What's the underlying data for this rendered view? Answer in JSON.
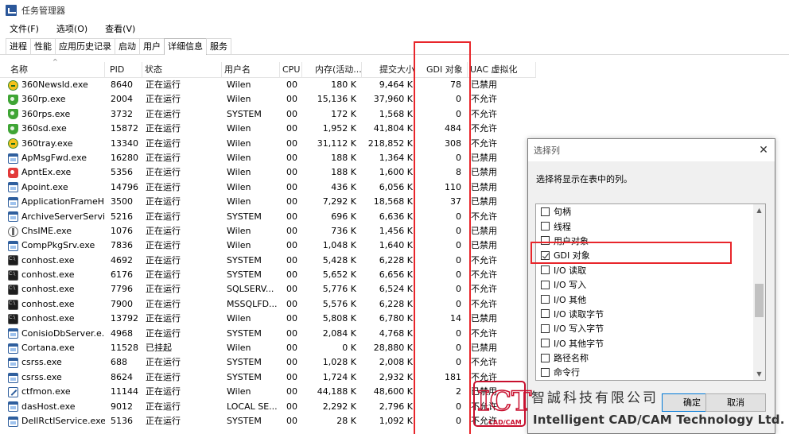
{
  "window": {
    "title": "任务管理器"
  },
  "menu": [
    "文件(F)",
    "选项(O)",
    "查看(V)"
  ],
  "tabs": [
    {
      "label": "进程",
      "active": false
    },
    {
      "label": "性能",
      "active": false
    },
    {
      "label": "应用历史记录",
      "active": false
    },
    {
      "label": "启动",
      "active": false
    },
    {
      "label": "用户",
      "active": false
    },
    {
      "label": "详细信息",
      "active": true
    },
    {
      "label": "服务",
      "active": false
    }
  ],
  "table": {
    "headers": {
      "name": "名称",
      "pid": "PID",
      "status": "状态",
      "user": "用户名",
      "cpu": "CPU",
      "memory": "内存(活动...",
      "commit": "提交大小",
      "gdi": "GDI 对象",
      "uac": "UAC 虚拟化"
    },
    "sorted_column": "name",
    "rows": [
      {
        "icon": "icon-360-ball",
        "name": "360Newsld.exe",
        "pid": "8640",
        "status": "正在运行",
        "user": "Wilen",
        "cpu": "00",
        "memory": "180 K",
        "commit": "9,464 K",
        "gdi": "78",
        "uac": "已禁用"
      },
      {
        "icon": "shield-icon",
        "name": "360rp.exe",
        "pid": "2004",
        "status": "正在运行",
        "user": "Wilen",
        "cpu": "00",
        "memory": "15,136 K",
        "commit": "37,960 K",
        "gdi": "0",
        "uac": "不允许"
      },
      {
        "icon": "shield-icon",
        "name": "360rps.exe",
        "pid": "3732",
        "status": "正在运行",
        "user": "SYSTEM",
        "cpu": "00",
        "memory": "172 K",
        "commit": "1,568 K",
        "gdi": "0",
        "uac": "不允许"
      },
      {
        "icon": "shield-icon",
        "name": "360sd.exe",
        "pid": "15872",
        "status": "正在运行",
        "user": "Wilen",
        "cpu": "00",
        "memory": "1,952 K",
        "commit": "41,804 K",
        "gdi": "484",
        "uac": "不允许"
      },
      {
        "icon": "icon-360-ball",
        "name": "360tray.exe",
        "pid": "13340",
        "status": "正在运行",
        "user": "Wilen",
        "cpu": "00",
        "memory": "31,112 K",
        "commit": "218,852 K",
        "gdi": "308",
        "uac": "不允许"
      },
      {
        "icon": "window-icon",
        "name": "ApMsgFwd.exe",
        "pid": "16280",
        "status": "正在运行",
        "user": "Wilen",
        "cpu": "00",
        "memory": "188 K",
        "commit": "1,364 K",
        "gdi": "0",
        "uac": "已禁用"
      },
      {
        "icon": "app-red-icon",
        "name": "ApntEx.exe",
        "pid": "5356",
        "status": "正在运行",
        "user": "Wilen",
        "cpu": "00",
        "memory": "188 K",
        "commit": "1,600 K",
        "gdi": "8",
        "uac": "已禁用"
      },
      {
        "icon": "window-icon",
        "name": "Apoint.exe",
        "pid": "14796",
        "status": "正在运行",
        "user": "Wilen",
        "cpu": "00",
        "memory": "436 K",
        "commit": "6,056 K",
        "gdi": "110",
        "uac": "已禁用"
      },
      {
        "icon": "window-icon",
        "name": "ApplicationFrameH...",
        "pid": "3500",
        "status": "正在运行",
        "user": "Wilen",
        "cpu": "00",
        "memory": "7,292 K",
        "commit": "18,568 K",
        "gdi": "37",
        "uac": "已禁用"
      },
      {
        "icon": "window-icon",
        "name": "ArchiveServerServi...",
        "pid": "5216",
        "status": "正在运行",
        "user": "SYSTEM",
        "cpu": "00",
        "memory": "696 K",
        "commit": "6,636 K",
        "gdi": "0",
        "uac": "不允许"
      },
      {
        "icon": "ime-icon",
        "name": "ChsIME.exe",
        "pid": "1076",
        "status": "正在运行",
        "user": "Wilen",
        "cpu": "00",
        "memory": "736 K",
        "commit": "1,456 K",
        "gdi": "0",
        "uac": "已禁用"
      },
      {
        "icon": "window-icon",
        "name": "CompPkgSrv.exe",
        "pid": "7836",
        "status": "正在运行",
        "user": "Wilen",
        "cpu": "00",
        "memory": "1,048 K",
        "commit": "1,640 K",
        "gdi": "0",
        "uac": "已禁用"
      },
      {
        "icon": "console-icon",
        "name": "conhost.exe",
        "pid": "4692",
        "status": "正在运行",
        "user": "SYSTEM",
        "cpu": "00",
        "memory": "5,428 K",
        "commit": "6,228 K",
        "gdi": "0",
        "uac": "不允许"
      },
      {
        "icon": "console-icon",
        "name": "conhost.exe",
        "pid": "6176",
        "status": "正在运行",
        "user": "SYSTEM",
        "cpu": "00",
        "memory": "5,652 K",
        "commit": "6,656 K",
        "gdi": "0",
        "uac": "不允许"
      },
      {
        "icon": "console-icon",
        "name": "conhost.exe",
        "pid": "7796",
        "status": "正在运行",
        "user": "SQLSERV...",
        "cpu": "00",
        "memory": "5,776 K",
        "commit": "6,524 K",
        "gdi": "0",
        "uac": "不允许"
      },
      {
        "icon": "console-icon",
        "name": "conhost.exe",
        "pid": "7900",
        "status": "正在运行",
        "user": "MSSQLFD...",
        "cpu": "00",
        "memory": "5,576 K",
        "commit": "6,228 K",
        "gdi": "0",
        "uac": "不允许"
      },
      {
        "icon": "console-icon",
        "name": "conhost.exe",
        "pid": "13792",
        "status": "正在运行",
        "user": "Wilen",
        "cpu": "00",
        "memory": "5,808 K",
        "commit": "6,780 K",
        "gdi": "14",
        "uac": "已禁用"
      },
      {
        "icon": "window-icon",
        "name": "ConisioDbServer.e...",
        "pid": "4968",
        "status": "正在运行",
        "user": "SYSTEM",
        "cpu": "00",
        "memory": "2,084 K",
        "commit": "4,768 K",
        "gdi": "0",
        "uac": "不允许"
      },
      {
        "icon": "window-icon",
        "name": "Cortana.exe",
        "pid": "11528",
        "status": "已挂起",
        "user": "Wilen",
        "cpu": "00",
        "memory": "0 K",
        "commit": "28,880 K",
        "gdi": "0",
        "uac": "已禁用"
      },
      {
        "icon": "window-icon",
        "name": "csrss.exe",
        "pid": "688",
        "status": "正在运行",
        "user": "SYSTEM",
        "cpu": "00",
        "memory": "1,028 K",
        "commit": "2,008 K",
        "gdi": "0",
        "uac": "不允许"
      },
      {
        "icon": "window-icon",
        "name": "csrss.exe",
        "pid": "8624",
        "status": "正在运行",
        "user": "SYSTEM",
        "cpu": "00",
        "memory": "1,724 K",
        "commit": "2,932 K",
        "gdi": "181",
        "uac": "不允许"
      },
      {
        "icon": "pen-icon",
        "name": "ctfmon.exe",
        "pid": "11144",
        "status": "正在运行",
        "user": "Wilen",
        "cpu": "00",
        "memory": "44,188 K",
        "commit": "48,600 K",
        "gdi": "2",
        "uac": "已禁用"
      },
      {
        "icon": "window-icon",
        "name": "dasHost.exe",
        "pid": "9012",
        "status": "正在运行",
        "user": "LOCAL SE...",
        "cpu": "00",
        "memory": "2,292 K",
        "commit": "2,796 K",
        "gdi": "0",
        "uac": "不允许"
      },
      {
        "icon": "window-icon",
        "name": "DellRctlService.exe",
        "pid": "5136",
        "status": "正在运行",
        "user": "SYSTEM",
        "cpu": "00",
        "memory": "28 K",
        "commit": "1,092 K",
        "gdi": "0",
        "uac": "不允许"
      }
    ]
  },
  "dialog": {
    "title": "选择列",
    "prompt": "选择将显示在表中的列。",
    "items": [
      {
        "label": "句柄",
        "checked": false
      },
      {
        "label": "线程",
        "checked": false
      },
      {
        "label": "用户对象",
        "checked": false
      },
      {
        "label": "GDI 对象",
        "checked": true
      },
      {
        "label": "I/O 读取",
        "checked": false
      },
      {
        "label": "I/O 写入",
        "checked": false
      },
      {
        "label": "I/O 其他",
        "checked": false
      },
      {
        "label": "I/O 读取字节",
        "checked": false
      },
      {
        "label": "I/O 写入字节",
        "checked": false
      },
      {
        "label": "I/O 其他字节",
        "checked": false
      },
      {
        "label": "路径名称",
        "checked": false
      },
      {
        "label": "命令行",
        "checked": false
      }
    ],
    "ok_label": "确定",
    "cancel_label": "取消"
  },
  "watermark": {
    "logo_text": "ICT",
    "logo_sub": "CAD/CAM",
    "company_cn": "智誠科技有限公司",
    "company_en": "Intelligent CAD/CAM Technology Ltd."
  },
  "colors": {
    "highlight": "#e8262b",
    "logo_red": "#c8102e"
  }
}
